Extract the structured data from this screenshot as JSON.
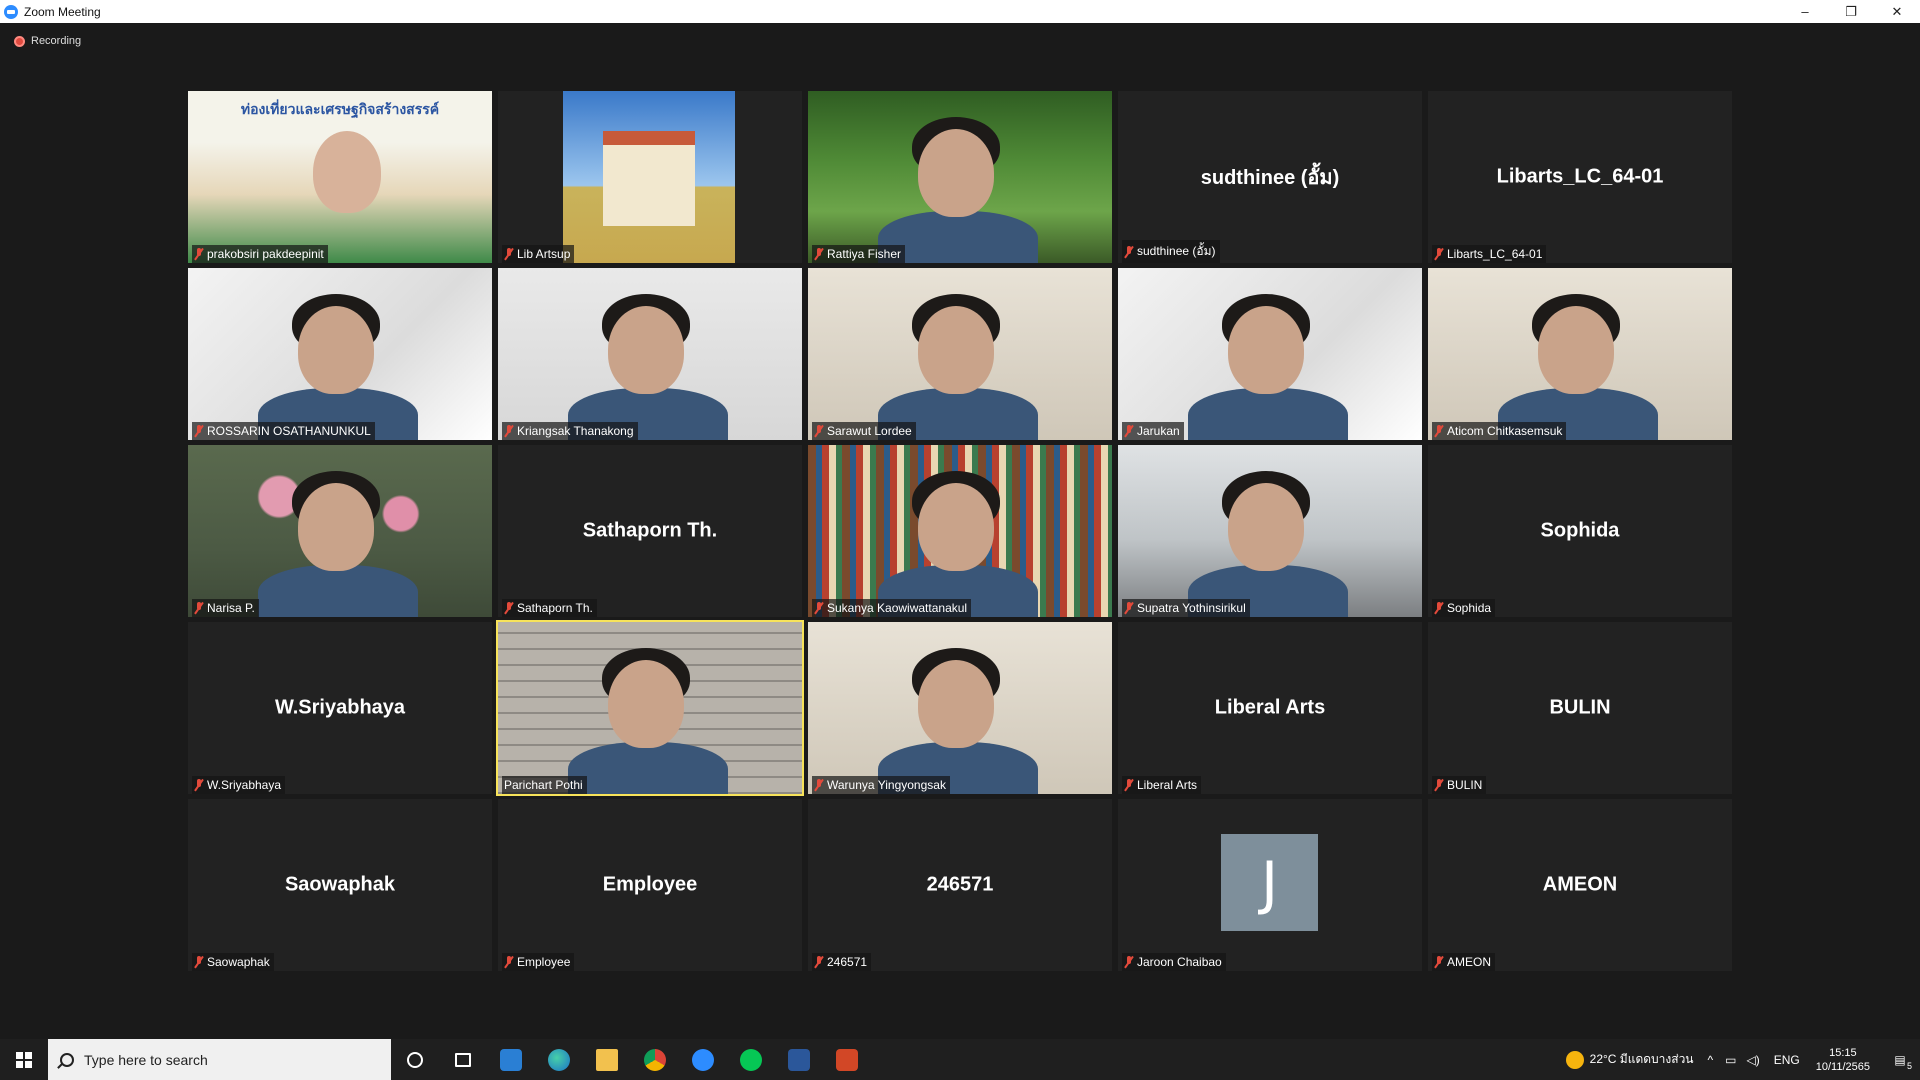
{
  "window": {
    "title": "Zoom Meeting",
    "controls": {
      "minimize": "–",
      "restore": "❐",
      "close": "✕"
    }
  },
  "recording": {
    "label": "Recording"
  },
  "participants": [
    {
      "name": "prakobsiri pakdeepinit",
      "display": "",
      "video": "poster",
      "poster_text": "ท่องเที่ยวและเศรษฐกิจสร้างสรรค์"
    },
    {
      "name": "Lib Artsup",
      "display": "",
      "video": "sky"
    },
    {
      "name": "Rattiya Fisher",
      "display": "",
      "video": "green"
    },
    {
      "name": "sudthinee (อั้ม)",
      "display": "sudthinee (อั้ม)",
      "video": ""
    },
    {
      "name": "Libarts_LC_64-01",
      "display": "Libarts_LC_64-01",
      "video": ""
    },
    {
      "name": "ROSSARIN OSATHANUNKUL",
      "display": "",
      "video": "white"
    },
    {
      "name": "Kriangsak Thanakong",
      "display": "",
      "video": "light"
    },
    {
      "name": "Sarawut Lordee",
      "display": "",
      "video": "room"
    },
    {
      "name": "Jarukan",
      "display": "",
      "video": "white"
    },
    {
      "name": "Aticom Chitkasemsuk",
      "display": "",
      "video": "room"
    },
    {
      "name": "Narisa P.",
      "display": "",
      "video": "lotus"
    },
    {
      "name": "Sathaporn Th.",
      "display": "Sathaporn Th.",
      "video": ""
    },
    {
      "name": "Sukanya Kaowiwattanakul",
      "display": "",
      "video": "books"
    },
    {
      "name": "Supatra Yothinsirikul",
      "display": "",
      "video": "office"
    },
    {
      "name": "Sophida",
      "display": "Sophida",
      "video": ""
    },
    {
      "name": "W.Sriyabhaya",
      "display": "W.Sriyabhaya",
      "video": ""
    },
    {
      "name": "Parichart Pothi",
      "display": "",
      "video": "brick",
      "active": true
    },
    {
      "name": "Warunya Yingyongsak",
      "display": "",
      "video": "room"
    },
    {
      "name": "Liberal Arts",
      "display": "Liberal Arts",
      "video": ""
    },
    {
      "name": "BULIN",
      "display": "BULIN",
      "video": ""
    },
    {
      "name": "Saowaphak",
      "display": "Saowaphak",
      "video": ""
    },
    {
      "name": "Employee",
      "display": "Employee",
      "video": ""
    },
    {
      "name": "246571",
      "display": "246571",
      "video": ""
    },
    {
      "name": "Jaroon Chaibao",
      "display": "",
      "video": "",
      "avatar_letter": "J"
    },
    {
      "name": "AMEON",
      "display": "AMEON",
      "video": ""
    }
  ],
  "taskbar": {
    "search_placeholder": "Type here to search",
    "apps": [
      "cortana-icon",
      "task-view-icon",
      "mail-icon",
      "edge-icon",
      "file-explorer-icon",
      "chrome-icon",
      "zoom-icon",
      "line-icon",
      "word-icon",
      "powerpoint-icon"
    ],
    "weather": "22°C  มีแดดบางส่วน",
    "language": "ENG",
    "time": "15:15",
    "date": "10/11/2565",
    "notifications": "5"
  },
  "colors": {
    "active_speaker": "#f7e35a",
    "mic_muted": "#e24a3b",
    "zoom_blue": "#2D8CFF"
  }
}
